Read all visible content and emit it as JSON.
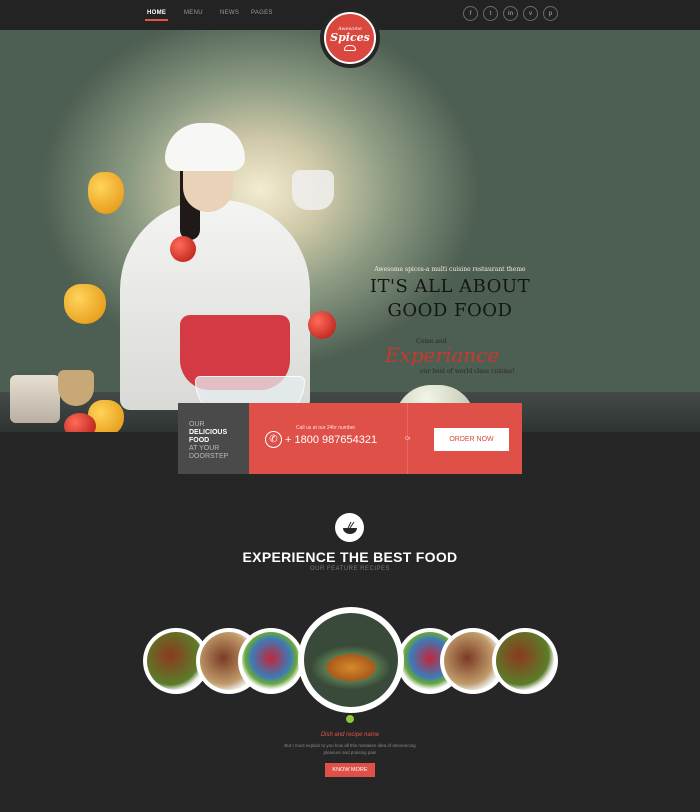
{
  "nav": {
    "items": [
      {
        "label": "HOME",
        "active": true
      },
      {
        "label": "MENU",
        "active": false
      },
      {
        "label": "NEWS",
        "active": false
      },
      {
        "label": "PAGES",
        "active": false
      }
    ],
    "social": [
      {
        "name": "facebook-icon",
        "glyph": "f"
      },
      {
        "name": "twitter-icon",
        "glyph": "t"
      },
      {
        "name": "linkedin-icon",
        "glyph": "in"
      },
      {
        "name": "vimeo-icon",
        "glyph": "v"
      },
      {
        "name": "pinterest-icon",
        "glyph": "p"
      }
    ]
  },
  "logo": {
    "top": "Awesome",
    "main": "Spices"
  },
  "hero": {
    "subtitle": "Awesome spices-a multi cuisine restaurant theme",
    "title_line1": "IT'S ALL ABOUT",
    "title_line2": "GOOD FOOD",
    "come": "Come and",
    "experience": "Experiance",
    "best": "our best of world class cuisine!"
  },
  "cta": {
    "line1": "OUR",
    "line2": "DELICIOUS",
    "line3": "FOOD",
    "line4": "AT YOUR",
    "line5": "DOORSTEP",
    "call_label": "Call us at our 24hr number",
    "phone": "+ 1800 987654321",
    "or": "Or",
    "order": "ORDER NOW"
  },
  "section": {
    "title": "EXPERIENCE THE BEST FOOD",
    "subtitle": "OUR FEATURE RECIPES"
  },
  "recipe": {
    "name": "Dish and recipe name",
    "description": "But I must explain to you how all this mistaken idea of denouncing pleasure and praising pain",
    "button": "KNOW MORE"
  },
  "colors": {
    "accent": "#df5049",
    "dark": "#262626",
    "grey_block": "#4a4a4a",
    "indicator": "#8fc63a"
  }
}
